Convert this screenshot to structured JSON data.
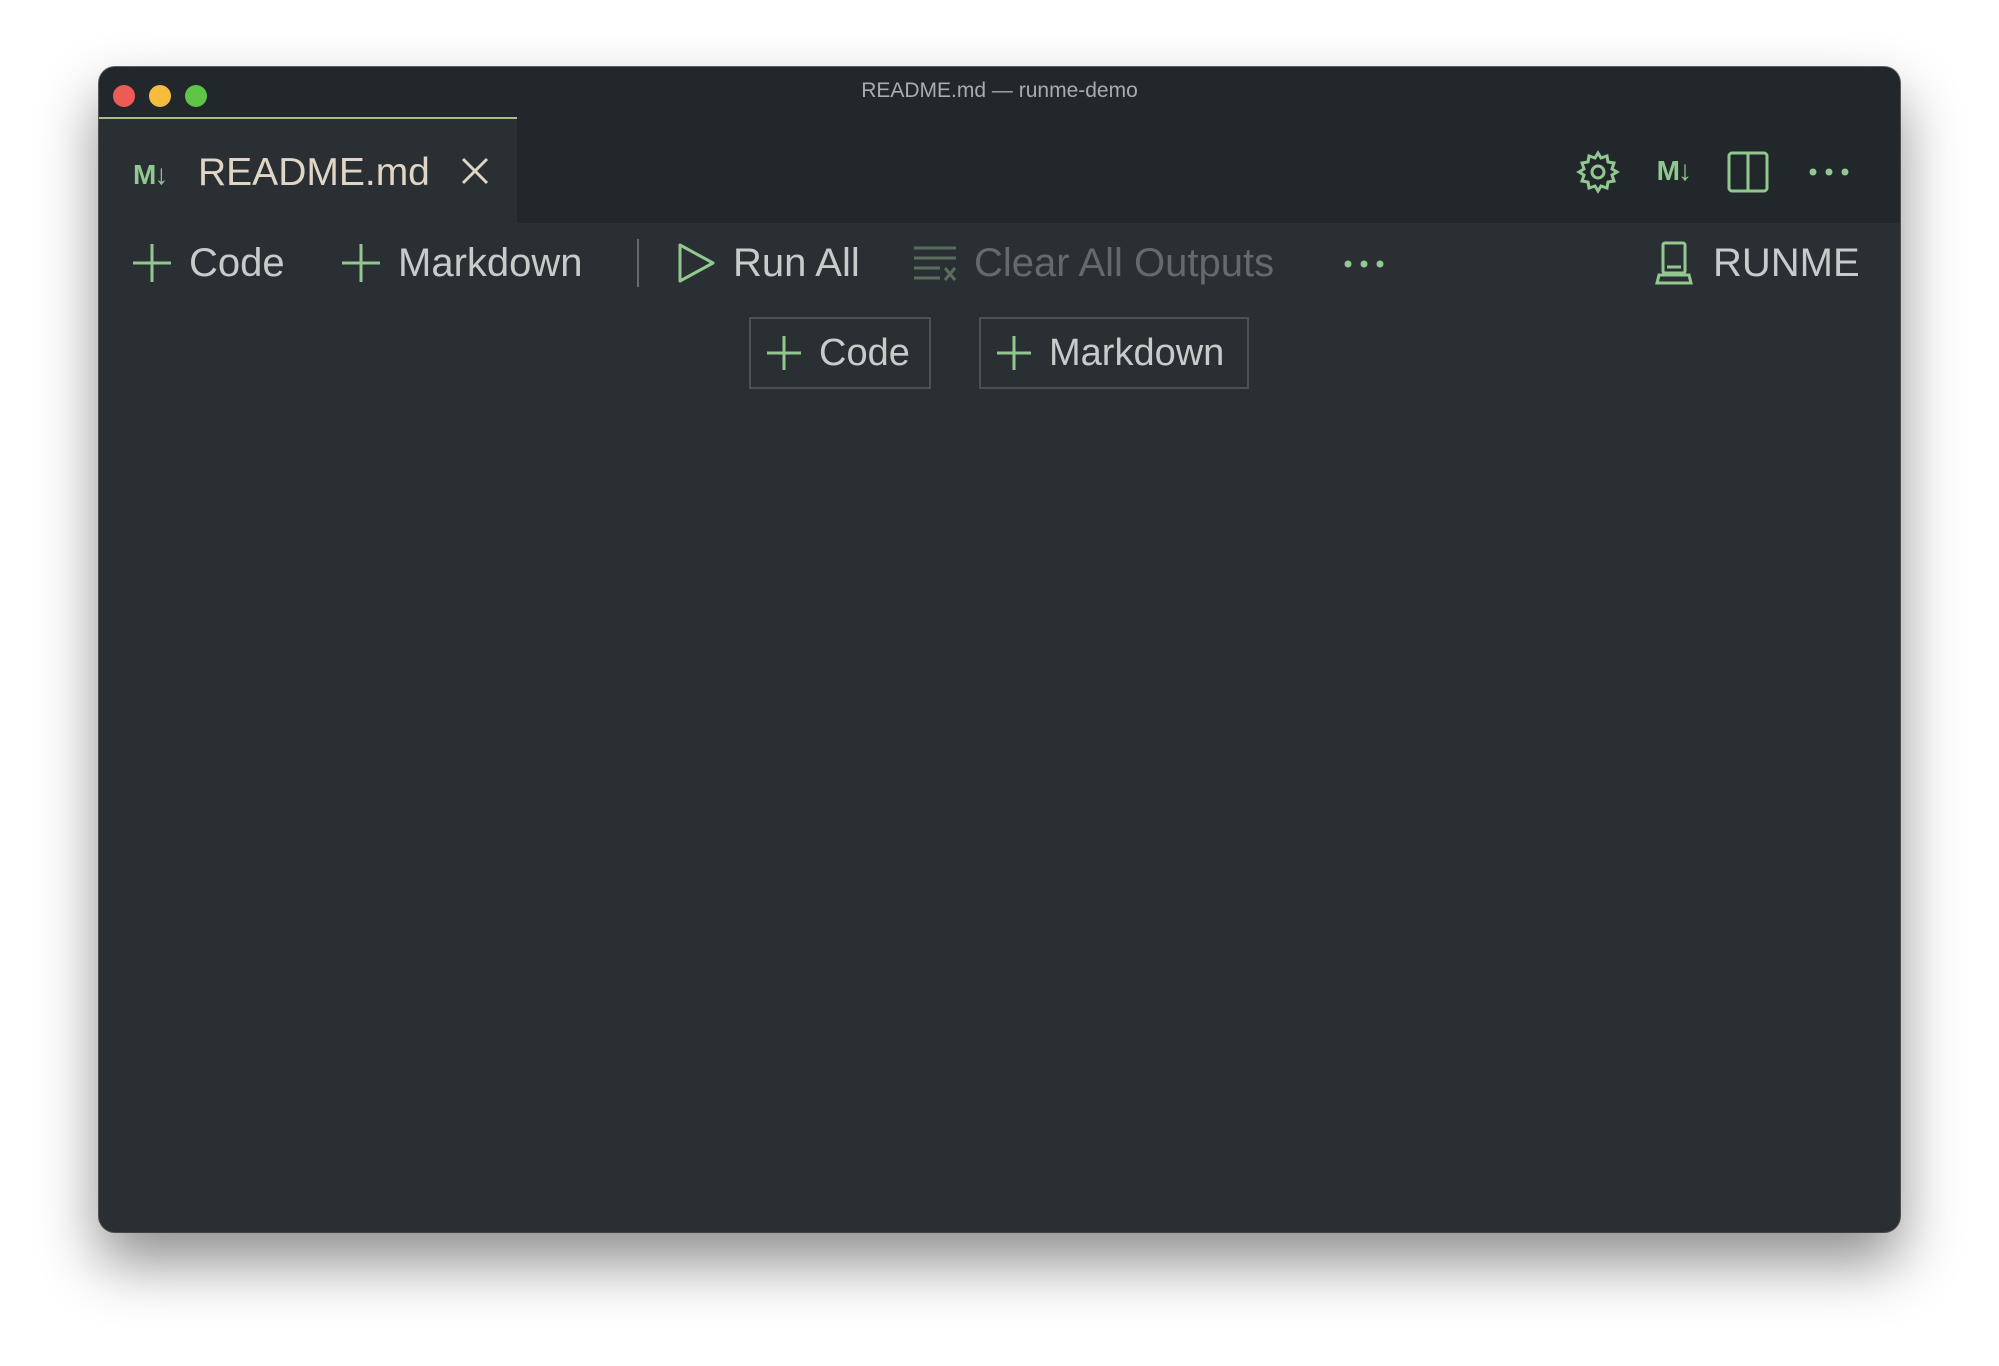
{
  "window": {
    "title": "README.md — runme-demo"
  },
  "tab": {
    "icon": "markdown-icon",
    "icon_text": "M↓",
    "label": "README.md"
  },
  "editor_actions": {
    "settings_icon": "gear-icon",
    "markdown_icon_text": "M↓",
    "split_icon": "split-editor-icon",
    "more_icon": "more-icon"
  },
  "toolbar": {
    "add_code_label": "Code",
    "add_markdown_label": "Markdown",
    "run_all_label": "Run All",
    "clear_outputs_label": "Clear All Outputs",
    "kernel_label": "RUNME"
  },
  "insert_buttons": {
    "code_label": "Code",
    "markdown_label": "Markdown"
  },
  "colors": {
    "accent_green": "#92c890",
    "background": "#2a2f33",
    "tab_bar": "#22272b",
    "text": "#c7cbc9",
    "tab_text": "#e0d6c6",
    "disabled_text": "#626a70"
  }
}
